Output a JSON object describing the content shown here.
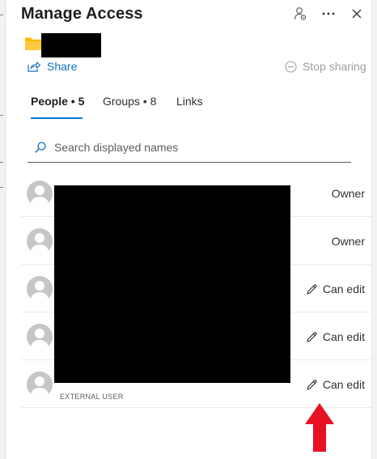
{
  "panel": {
    "title": "Manage Access",
    "header_icons": [
      "person-settings-icon",
      "more-icon",
      "close-icon"
    ]
  },
  "item": {
    "icon": "folder-icon",
    "folder_color": "#ffb900"
  },
  "actions": {
    "share_label": "Share",
    "share_icon": "share-icon",
    "stop_sharing_label": "Stop sharing",
    "stop_sharing_icon": "stop-icon"
  },
  "tabs": [
    {
      "label": "People • 5",
      "active": true
    },
    {
      "label": "Groups • 8",
      "active": false
    },
    {
      "label": "Links",
      "active": false
    }
  ],
  "search": {
    "placeholder": "Search displayed names",
    "value": ""
  },
  "people": [
    {
      "permission": "Owner",
      "editable": false,
      "sublabel": ""
    },
    {
      "permission": "Owner",
      "editable": false,
      "sublabel": ""
    },
    {
      "permission": "Can edit",
      "editable": true,
      "sublabel": ""
    },
    {
      "permission": "Can edit",
      "editable": true,
      "sublabel": ""
    },
    {
      "permission": "Can edit",
      "editable": true,
      "sublabel": "EXTERNAL USER"
    }
  ],
  "colors": {
    "accent": "#0078d4",
    "link": "#106ebe",
    "annotation_arrow": "#e81123"
  }
}
